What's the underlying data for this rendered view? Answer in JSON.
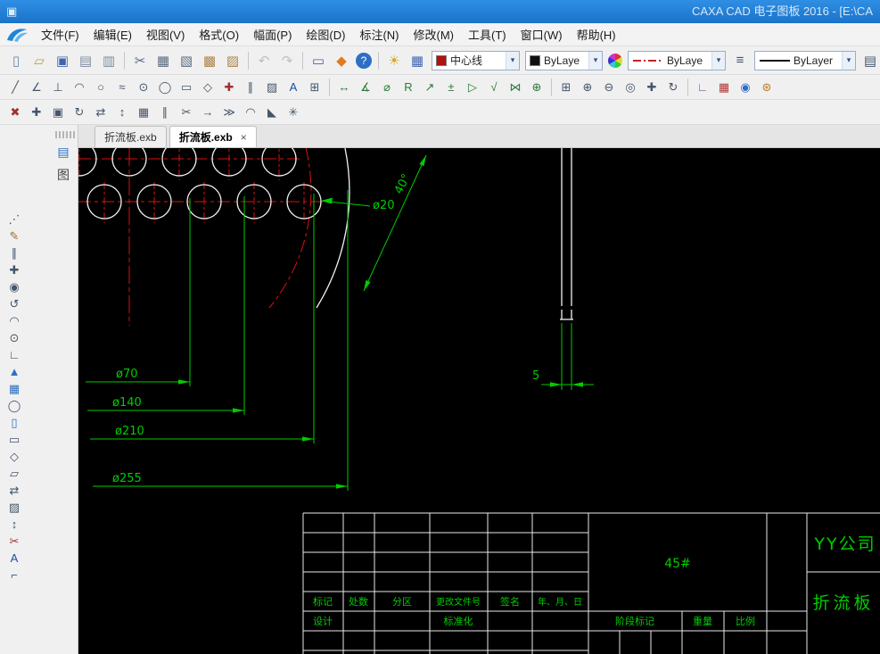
{
  "window": {
    "title": "CAXA CAD 电子图板 2016 - [E:\\CA"
  },
  "menu": {
    "items": [
      "文件(F)",
      "编辑(E)",
      "视图(V)",
      "格式(O)",
      "幅面(P)",
      "绘图(D)",
      "标注(N)",
      "修改(M)",
      "工具(T)",
      "窗口(W)",
      "帮助(H)"
    ]
  },
  "toolbar_main": {
    "icons": [
      {
        "name": "new-icon",
        "glyph": "▯",
        "color": "#6b86ad"
      },
      {
        "name": "open-icon",
        "glyph": "▱",
        "color": "#c79a3d"
      },
      {
        "name": "save-icon",
        "glyph": "▣",
        "color": "#3f66ad"
      },
      {
        "name": "print-preview-icon",
        "glyph": "▤",
        "color": "#7d8ba0"
      },
      {
        "name": "print-icon",
        "glyph": "▥",
        "color": "#7d8ba0"
      },
      {
        "sep": true
      },
      {
        "name": "cut-icon",
        "glyph": "✂",
        "color": "#5a6b80"
      },
      {
        "name": "copy-icon",
        "glyph": "▦",
        "color": "#5a6b80"
      },
      {
        "name": "copy-basepoint-icon",
        "glyph": "▧",
        "color": "#5a6b80"
      },
      {
        "name": "paste-icon",
        "glyph": "▩",
        "color": "#ad8448"
      },
      {
        "name": "paste-special-icon",
        "glyph": "▨",
        "color": "#ad8448"
      },
      {
        "sep": true
      },
      {
        "name": "undo-icon",
        "glyph": "↶",
        "color": "#b9c0ca"
      },
      {
        "name": "redo-icon",
        "glyph": "↷",
        "color": "#b9c0ca"
      },
      {
        "sep": true
      },
      {
        "name": "paper-frame-icon",
        "glyph": "▭",
        "color": "#3f66ad"
      },
      {
        "name": "plot-icon",
        "glyph": "◆",
        "color": "#e07b20"
      },
      {
        "name": "help-icon",
        "glyph": "?",
        "color": "#ffffff",
        "bg": "#2e6fc4"
      },
      {
        "sep": true
      },
      {
        "name": "layer-bulb-icon",
        "glyph": "☀",
        "color": "#d8a61c"
      },
      {
        "name": "layer-manager-icon",
        "glyph": "▦",
        "color": "#3f66ad"
      }
    ]
  },
  "combos": {
    "arrow": "▾",
    "layer": {
      "value": "中心线",
      "chip": "#b01010"
    },
    "color": {
      "value": "ByLaye",
      "chip": "#101010"
    },
    "linetype": {
      "value": "ByLaye"
    },
    "linewidth": {
      "value": "ByLayer"
    }
  },
  "toolbar_draw": {
    "icons": [
      {
        "name": "line-icon",
        "glyph": "╱",
        "color": "#44566b"
      },
      {
        "name": "angular-line-icon",
        "glyph": "∠",
        "color": "#44566b"
      },
      {
        "name": "perpendicular-line-icon",
        "glyph": "⊥",
        "color": "#44566b"
      },
      {
        "name": "arc-icon",
        "glyph": "◠",
        "color": "#44566b"
      },
      {
        "name": "circle-icon",
        "glyph": "○",
        "color": "#44566b"
      },
      {
        "name": "spline-icon",
        "glyph": "≈",
        "color": "#44566b"
      },
      {
        "name": "point-icon",
        "glyph": "⊙",
        "color": "#44566b"
      },
      {
        "name": "ellipse-icon",
        "glyph": "◯",
        "color": "#44566b"
      },
      {
        "name": "rectangle-icon",
        "glyph": "▭",
        "color": "#44566b"
      },
      {
        "name": "polygon-icon",
        "glyph": "◇",
        "color": "#44566b"
      },
      {
        "name": "centerline-icon",
        "glyph": "✚",
        "color": "#a03030"
      },
      {
        "name": "equidistant-line-icon",
        "glyph": "∥",
        "color": "#44566b"
      },
      {
        "name": "hatch-icon",
        "glyph": "▨",
        "color": "#44566b"
      },
      {
        "name": "text-icon",
        "glyph": "A",
        "color": "#1a4fa0"
      },
      {
        "name": "table-icon",
        "glyph": "⊞",
        "color": "#44566b"
      },
      {
        "sep": true
      },
      {
        "name": "linear-dimension-icon",
        "glyph": "↔",
        "color": "#2f7a3a"
      },
      {
        "name": "angle-dimension-icon",
        "glyph": "∡",
        "color": "#2f7a3a"
      },
      {
        "name": "diameter-dimension-icon",
        "glyph": "⌀",
        "color": "#2f7a3a"
      },
      {
        "name": "radius-dimension-icon",
        "glyph": "R",
        "color": "#2f7a3a"
      },
      {
        "name": "leader-icon",
        "glyph": "↗",
        "color": "#2f7a3a"
      },
      {
        "name": "tolerance-icon",
        "glyph": "±",
        "color": "#2f7a3a"
      },
      {
        "name": "datum-icon",
        "glyph": "▷",
        "color": "#2f7a3a"
      },
      {
        "name": "roughness-icon",
        "glyph": "√",
        "color": "#2f7a3a"
      },
      {
        "name": "weld-symbol-icon",
        "glyph": "⋈",
        "color": "#2f7a3a"
      },
      {
        "name": "center-mark-icon",
        "glyph": "⊕",
        "color": "#2f7a3a"
      },
      {
        "sep": true
      },
      {
        "name": "zoom-window-icon",
        "glyph": "⊞",
        "color": "#44566b"
      },
      {
        "name": "zoom-in-icon",
        "glyph": "⊕",
        "color": "#44566b"
      },
      {
        "name": "zoom-out-icon",
        "glyph": "⊖",
        "color": "#44566b"
      },
      {
        "name": "zoom-all-icon",
        "glyph": "◎",
        "color": "#44566b"
      },
      {
        "name": "pan-icon",
        "glyph": "✚",
        "color": "#44566b"
      },
      {
        "name": "regen-icon",
        "glyph": "↻",
        "color": "#44566b"
      },
      {
        "sep": true
      },
      {
        "name": "ortho-icon",
        "glyph": "∟",
        "color": "#8a4fa0"
      },
      {
        "name": "grid-icon",
        "glyph": "▦",
        "color": "#b03838"
      },
      {
        "name": "osnap-icon",
        "glyph": "◉",
        "color": "#2e6fc4"
      },
      {
        "name": "color-set-icon",
        "glyph": "⊛",
        "color": "#c07820"
      }
    ]
  },
  "toolbar_edit": {
    "icons": [
      {
        "name": "erase-icon",
        "glyph": "✖",
        "color": "#a03030"
      },
      {
        "name": "move-icon",
        "glyph": "✚",
        "color": "#44566b"
      },
      {
        "name": "copy-object-icon",
        "glyph": "▣",
        "color": "#44566b"
      },
      {
        "name": "rotate-icon",
        "glyph": "↻",
        "color": "#44566b"
      },
      {
        "name": "mirror-icon",
        "glyph": "⇄",
        "color": "#44566b"
      },
      {
        "name": "scale-icon",
        "glyph": "↕",
        "color": "#44566b"
      },
      {
        "name": "array-icon",
        "glyph": "▦",
        "color": "#44566b"
      },
      {
        "name": "offset-icon",
        "glyph": "∥",
        "color": "#44566b"
      },
      {
        "name": "trim-icon",
        "glyph": "✂",
        "color": "#44566b"
      },
      {
        "name": "extend-icon",
        "glyph": "→",
        "color": "#44566b"
      },
      {
        "name": "break-icon",
        "glyph": "≫",
        "color": "#44566b"
      },
      {
        "name": "fillet-icon",
        "glyph": "◠",
        "color": "#44566b"
      },
      {
        "name": "chamfer-icon",
        "glyph": "◣",
        "color": "#44566b"
      },
      {
        "name": "explode-icon",
        "glyph": "✳",
        "color": "#44566b"
      }
    ]
  },
  "left_toolbar": {
    "icons": [
      {
        "name": "snap-settings-icon",
        "glyph": "⋰",
        "color": "#44566b"
      },
      {
        "name": "sketch-icon",
        "glyph": "✎",
        "color": "#9a6a2f"
      },
      {
        "name": "parallel-line-icon",
        "glyph": "∥",
        "color": "#44566b"
      },
      {
        "name": "translate-icon",
        "glyph": "✚",
        "color": "#44566b"
      },
      {
        "name": "circle-tool-icon",
        "glyph": "◉",
        "color": "#44566b"
      },
      {
        "name": "rotate-tool-icon",
        "glyph": "↺",
        "color": "#44566b"
      },
      {
        "name": "arc-tool-icon",
        "glyph": "◠",
        "color": "#44566b"
      },
      {
        "name": "point-tool-icon",
        "glyph": "⊙",
        "color": "#44566b"
      },
      {
        "name": "perpendicular-tool-icon",
        "glyph": "∟",
        "color": "#44566b"
      },
      {
        "name": "cone-icon",
        "glyph": "▲",
        "color": "#2e6fc4"
      },
      {
        "name": "array-tool-icon",
        "glyph": "▦",
        "color": "#2e6fc4"
      },
      {
        "name": "ellipse-tool-icon",
        "glyph": "◯",
        "color": "#44566b"
      },
      {
        "name": "new-sheet-icon",
        "glyph": "▯",
        "color": "#2e6fc4"
      },
      {
        "name": "rectangle-tool-icon",
        "glyph": "▭",
        "color": "#44566b"
      },
      {
        "name": "polygon-tool-icon",
        "glyph": "◇",
        "color": "#44566b"
      },
      {
        "name": "parallelogram-icon",
        "glyph": "▱",
        "color": "#44566b"
      },
      {
        "name": "mirror-tool-icon",
        "glyph": "⇄",
        "color": "#44566b"
      },
      {
        "name": "hatch-tool-icon",
        "glyph": "▨",
        "color": "#44566b"
      },
      {
        "name": "stretch-icon",
        "glyph": "↕",
        "color": "#44566b"
      },
      {
        "name": "trim-tool-icon",
        "glyph": "✂",
        "color": "#a03030"
      },
      {
        "name": "text-tool-icon",
        "glyph": "A",
        "color": "#1a4fa0"
      },
      {
        "name": "formula-icon",
        "glyph": "⌐",
        "color": "#44566b"
      }
    ]
  },
  "palette": {
    "icons": [
      {
        "name": "sheet-palette-icon",
        "glyph": "▤",
        "color": "#2e6fc4"
      },
      {
        "name": "library-palette-icon",
        "glyph": "图",
        "color": "#444444"
      }
    ]
  },
  "tabs": [
    {
      "label": "折流板.exb"
    },
    {
      "label": "折流板.exb"
    }
  ],
  "tab_close": "×",
  "drawing": {
    "dimensions": {
      "hole_dia": "ø20",
      "hole_angle": "40°",
      "d70": "ø70",
      "d140": "ø140",
      "d210": "ø210",
      "d255": "ø255",
      "thickness": "5"
    },
    "colors": {
      "outline": "#f2f2f2",
      "centerline": "#dd1111",
      "dimension": "#00cc00"
    },
    "title_block": {
      "headers": [
        "标记",
        "处数",
        "分区",
        "更改文件号",
        "签名",
        "年、月、日"
      ],
      "design": "设计",
      "standardization": "标准化",
      "stage_mark": "阶段标记",
      "weight": "重量",
      "scale": "比例",
      "material": "45#",
      "company": "YY公司",
      "part_name": "折流板"
    }
  }
}
